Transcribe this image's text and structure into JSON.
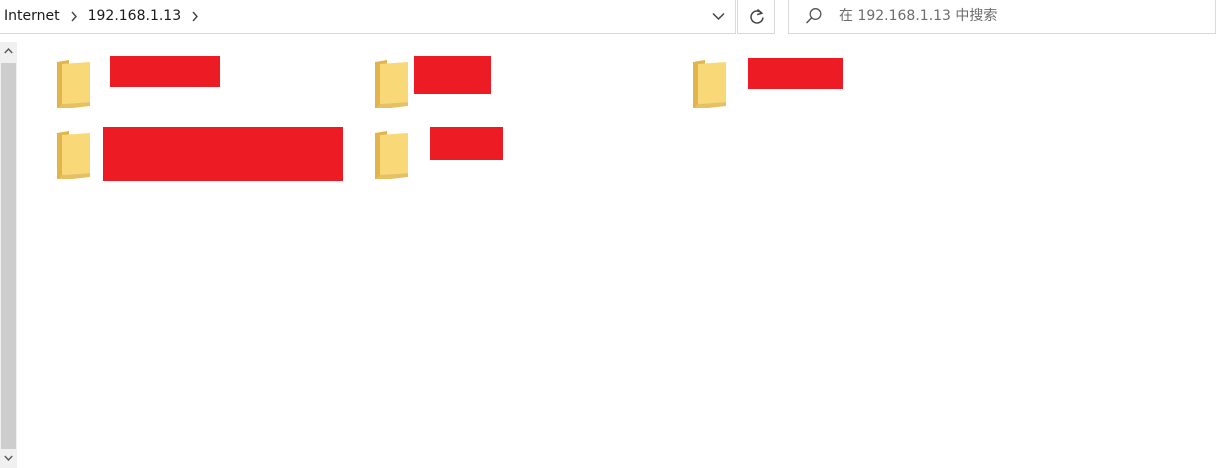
{
  "address_bar": {
    "breadcrumbs": [
      "Internet",
      "192.168.1.13"
    ],
    "chevron_icon": "chevron-right-icon",
    "dropdown_icon": "chevron-down-icon",
    "refresh_icon": "refresh-icon"
  },
  "search": {
    "placeholder": "在 192.168.1.13 中搜索",
    "icon": "search-icon"
  },
  "folders": [
    {
      "name": "",
      "redacted": true,
      "icon": "folder-icon"
    },
    {
      "name": "",
      "redacted": true,
      "icon": "folder-icon"
    },
    {
      "name": "",
      "redacted": true,
      "icon": "folder-icon"
    },
    {
      "name": "",
      "redacted": true,
      "icon": "folder-icon"
    },
    {
      "name": "",
      "redacted": true,
      "icon": "folder-icon"
    }
  ],
  "colors": {
    "redaction": "#ed1c24",
    "folder_front": "#f8d775",
    "folder_back": "#e8b94a",
    "border": "#d9d9d9",
    "scroll_thumb": "#cdcdcd"
  }
}
